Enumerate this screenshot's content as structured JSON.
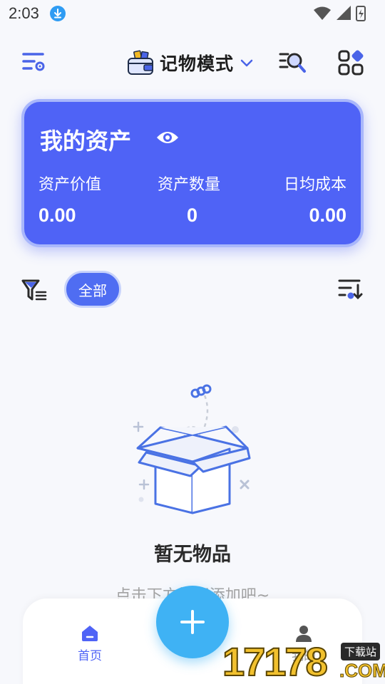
{
  "status_bar": {
    "time": "2:03"
  },
  "top_bar": {
    "mode_title": "记物模式"
  },
  "asset_card": {
    "title": "我的资产",
    "stats": [
      {
        "label": "资产价值",
        "value": "0.00"
      },
      {
        "label": "资产数量",
        "value": "0"
      },
      {
        "label": "日均成本",
        "value": "0.00"
      }
    ]
  },
  "filter": {
    "chip_label": "全部"
  },
  "empty_state": {
    "title": "暂无物品",
    "hint": "点击下方按钮添加吧~"
  },
  "bottom_nav": {
    "home_label": "首页",
    "mine_label": "我的"
  },
  "watermark": {
    "digits": "17178",
    "tag": "下载站",
    "suffix": ".COM"
  },
  "colors": {
    "primary": "#4f63f6",
    "fab": "#3fb2f4",
    "background": "#f7f8fc"
  }
}
